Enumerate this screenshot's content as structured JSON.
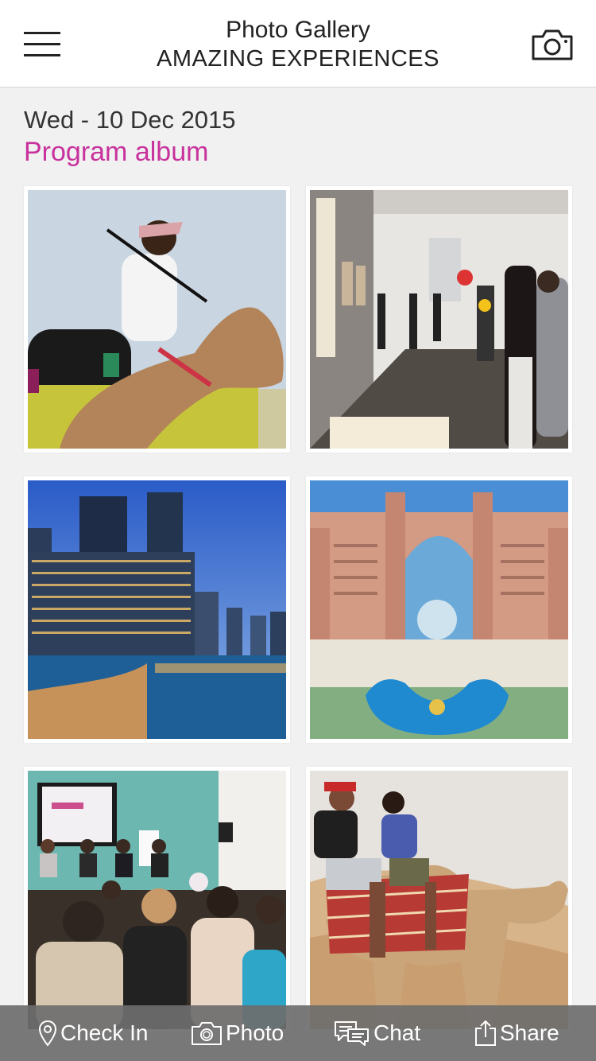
{
  "header": {
    "title": "Photo Gallery",
    "subtitle": "AMAZING EXPERIENCES",
    "menu_icon": "hamburger-menu-icon",
    "camera_icon": "camera-icon"
  },
  "album": {
    "date": "Wed - 10 Dec 2015",
    "name": "Program album",
    "name_color": "#c8329c"
  },
  "photos": [
    {
      "subject": "camel-rider"
    },
    {
      "subject": "art-gallery-visitors"
    },
    {
      "subject": "marina-towers-night"
    },
    {
      "subject": "resort-hotel-aerial"
    },
    {
      "subject": "conference-audience"
    },
    {
      "subject": "desert-camel-ride"
    }
  ],
  "tabbar": {
    "checkin": "Check In",
    "photo": "Photo",
    "chat": "Chat",
    "share": "Share"
  }
}
